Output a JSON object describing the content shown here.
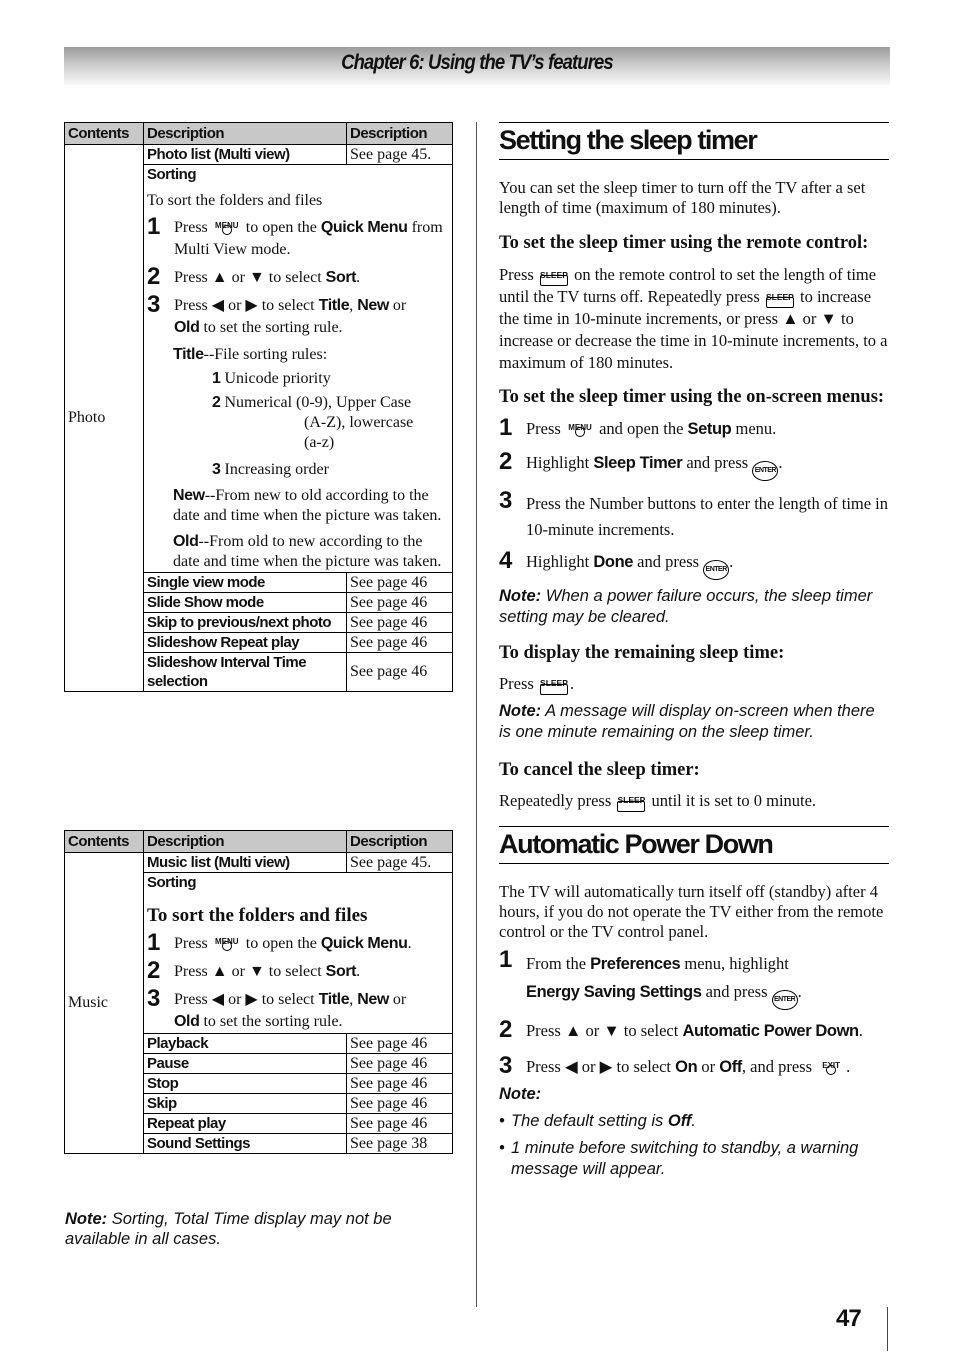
{
  "header": {
    "chapter_title": "Chapter 6: Using the TV’s features"
  },
  "photo_table": {
    "headers": [
      "Contents",
      "Description",
      "Description"
    ],
    "contents_label": "Photo",
    "first_row": {
      "feature": "Photo list (Multi view)",
      "ref": "See page 45."
    },
    "sorting": {
      "title": "Sorting",
      "intro": "To sort the folders and files",
      "steps": [
        {
          "num": "1",
          "pre": "Press",
          "icon": "menu-button-icon",
          "icon_label": "MENU",
          "mid": "to open the",
          "bold": "Quick Menu",
          "post": "from Multi View mode."
        },
        {
          "num": "2",
          "pre": "Press",
          "up": "▲",
          "or": "or",
          "down": "▼",
          "mid": "to select",
          "bold": "Sort",
          "post": "."
        },
        {
          "num": "3",
          "pre": "Press",
          "left": "◀",
          "or": "or",
          "right": "▶",
          "mid": "to select",
          "b1": "Title",
          "sep": ",",
          "b2": "New",
          "or2": "or",
          "b3": "Old",
          "post": "to set the sorting rule."
        }
      ],
      "title_rule": {
        "bold": "Title",
        "text": "--File sorting rules:"
      },
      "rules": [
        {
          "num": "1",
          "text": "Unicode priority"
        },
        {
          "num": "2",
          "text": "Numerical (0-9), Upper Case",
          "cont1": "(A-Z), lowercase",
          "cont2": "(a-z)"
        },
        {
          "num": "3",
          "text": "Increasing order"
        }
      ],
      "new_rule": {
        "bold": "New",
        "text": "--From new to old according to the date and time when the picture was taken."
      },
      "old_rule": {
        "bold": "Old",
        "text": "--From old to new according to the date and time when the picture was taken."
      }
    },
    "rows": [
      {
        "feature": "Single view mode",
        "ref": "See page 46"
      },
      {
        "feature": "Slide Show mode",
        "ref": "See page 46"
      },
      {
        "feature": "Skip to previous/next photo",
        "ref": "See page 46"
      },
      {
        "feature": "Slideshow Repeat play",
        "ref": "See page 46"
      },
      {
        "feature": "Slideshow Interval Time selection",
        "ref": "See page 46"
      }
    ]
  },
  "music_table": {
    "headers": [
      "Contents",
      "Description",
      "Description"
    ],
    "contents_label": "Music",
    "first_row": {
      "feature": "Music list (Multi view)",
      "ref": "See page 45."
    },
    "sorting": {
      "title": "Sorting",
      "intro": "To sort the folders and files",
      "steps": [
        {
          "num": "1",
          "pre": "Press",
          "icon_label": "MENU",
          "mid": "to open the",
          "bold": "Quick Menu",
          "post": "."
        },
        {
          "num": "2",
          "pre": "Press",
          "up": "▲",
          "or": "or",
          "down": "▼",
          "mid": "to select",
          "bold": "Sort",
          "post": "."
        },
        {
          "num": "3",
          "pre": "Press",
          "left": "◀",
          "or": "or",
          "right": "▶",
          "mid": "to select",
          "b1": "Title",
          "sep": ",",
          "b2": "New",
          "or2": "or",
          "b3": "Old",
          "post": "to set the sorting rule."
        }
      ]
    },
    "rows": [
      {
        "feature": "Playback",
        "ref": "See page 46"
      },
      {
        "feature": "Pause",
        "ref": "See page 46"
      },
      {
        "feature": "Stop",
        "ref": "See page 46"
      },
      {
        "feature": "Skip",
        "ref": "See page 46"
      },
      {
        "feature": "Repeat play",
        "ref": "See page 46"
      },
      {
        "feature": "Sound Settings",
        "ref": "See page 38"
      }
    ]
  },
  "left_note": {
    "label": "Note:",
    "text": "Sorting, Total Time display may not be available in all cases."
  },
  "sleep_timer": {
    "title": "Setting the sleep timer",
    "intro": "You can set the sleep timer to turn off the TV after a set length of time (maximum of 180 minutes).",
    "remote_heading": "To set the sleep timer using the remote control:",
    "remote_text": {
      "p1": "Press",
      "sleep_label": "SLEEP",
      "p2": "on the remote control to set the length of time until the TV turns off. Repeatedly press",
      "p3": "to increase the time in 10-minute increments, or press",
      "up": "▲",
      "or": "or",
      "down": "▼",
      "p4": "to increase or decrease the time in 10-minute increments, to a maximum of 180 minutes."
    },
    "menu_heading": "To set the sleep timer using the on-screen menus:",
    "menu_steps": [
      {
        "num": "1",
        "pre": "Press",
        "icon_label": "MENU",
        "mid": "and open the",
        "bold": "Setup",
        "post": "menu."
      },
      {
        "num": "2",
        "pre": "Highlight",
        "bold": "Sleep Timer",
        "mid": "and press",
        "enter_label": "ENTER",
        "post": "."
      },
      {
        "num": "3",
        "text": "Press the Number buttons to enter the length of time in 10-minute increments."
      },
      {
        "num": "4",
        "pre": "Highlight",
        "bold": "Done",
        "mid": "and press",
        "enter_label": "ENTER",
        "post": "."
      }
    ],
    "note1": {
      "label": "Note:",
      "text": "When a power failure occurs, the sleep timer setting may be cleared."
    },
    "display_heading": "To display the remaining sleep time:",
    "display_text": {
      "pre": "Press",
      "sleep_label": "SLEEP",
      "post": "."
    },
    "note2": {
      "label": "Note:",
      "text": "A message will display on-screen when there is one minute remaining on the sleep timer."
    },
    "cancel_heading": "To cancel the sleep timer:",
    "cancel_text": {
      "pre": "Repeatedly press",
      "sleep_label": "SLEEP",
      "post": "until it is set to 0 minute."
    }
  },
  "auto_power": {
    "title": "Automatic Power Down",
    "intro": "The TV will automatically turn itself off (standby) after 4 hours, if you do not operate the TV either from the remote control or the TV control panel.",
    "steps": [
      {
        "num": "1",
        "pre": "From the",
        "b1": "Preferences",
        "mid": "menu, highlight",
        "b2": "Energy Saving Settings",
        "mid2": "and press",
        "enter_label": "ENTER",
        "post": "."
      },
      {
        "num": "2",
        "pre": "Press",
        "up": "▲",
        "or": "or",
        "down": "▼",
        "mid": "to select",
        "bold": "Automatic Power Down",
        "post": "."
      },
      {
        "num": "3",
        "pre": "Press",
        "left": "◀",
        "or": "or",
        "right": "▶",
        "mid": "to select",
        "b1": "On",
        "or2": "or",
        "b2": "Off",
        "mid2": ", and press",
        "exit_label": "EXIT",
        "post": "."
      }
    ],
    "note_label": "Note:",
    "bullets": [
      {
        "text": "The default setting is",
        "bold": "Off",
        "post": "."
      },
      {
        "text": "1 minute before switching to standby, a warning message will appear."
      }
    ]
  },
  "page_number": "47"
}
